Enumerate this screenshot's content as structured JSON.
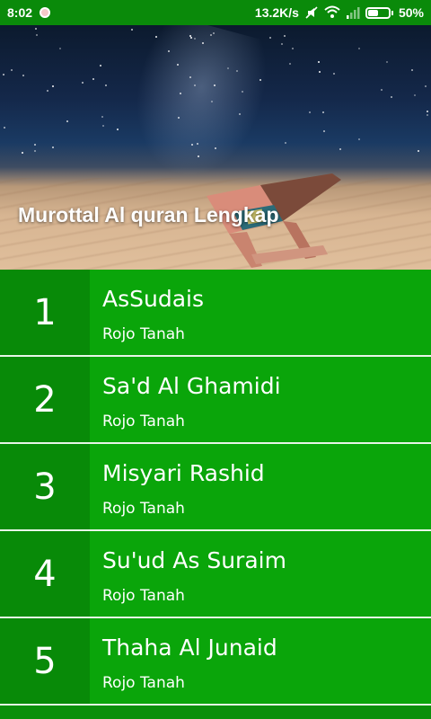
{
  "status_bar": {
    "time": "8:02",
    "speed": "13.2K/s",
    "battery": "50%",
    "battery_level": 0.5
  },
  "header": {
    "title": "Murottal Al quran Lengkap"
  },
  "reciters": [
    {
      "number": "1",
      "name": "AsSudais",
      "subtitle": "Rojo Tanah"
    },
    {
      "number": "2",
      "name": "Sa'd Al Ghamidi",
      "subtitle": "Rojo Tanah"
    },
    {
      "number": "3",
      "name": "Misyari Rashid",
      "subtitle": "Rojo Tanah"
    },
    {
      "number": "4",
      "name": "Su'ud As Suraim",
      "subtitle": "Rojo Tanah"
    },
    {
      "number": "5",
      "name": "Thaha Al Junaid",
      "subtitle": "Rojo Tanah"
    }
  ],
  "colors": {
    "primary": "#0aa50a",
    "number_bg": "#088a08",
    "status_bar": "#0a8a0a"
  }
}
